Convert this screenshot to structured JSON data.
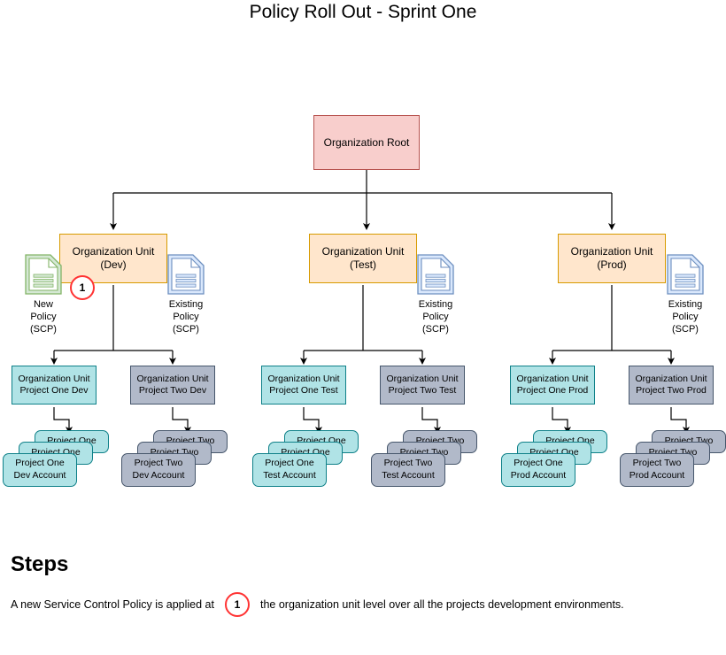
{
  "title": "Policy Roll Out - Sprint One",
  "colors": {
    "root_fill": "#f8cecc",
    "root_stroke": "#b85450",
    "ou_fill": "#ffe6cc",
    "ou_stroke": "#d79b00",
    "teal_fill": "#b0e3e6",
    "teal_stroke": "#0e8088",
    "slate_fill": "#b1b9c9",
    "slate_stroke": "#46566b",
    "badge_stroke": "#ff3333",
    "new_policy": "#82b366",
    "existing_policy": "#6c8ebf",
    "wire": "#000000"
  },
  "root": {
    "label": "Organization Root"
  },
  "branches": [
    {
      "ou_label_line1": "Organization Unit",
      "ou_label_line2": "(Dev)",
      "new_policy": {
        "icon": "document-icon",
        "label_line1": "New",
        "label_line2": "Policy",
        "label_line3": "(SCP)"
      },
      "existing_policy": {
        "icon": "document-icon",
        "label_line1": "Existing",
        "label_line2": "Policy",
        "label_line3": "(SCP)"
      },
      "badge": "1",
      "projects": [
        {
          "unit_line1": "Organization Unit",
          "unit_line2": "Project One Dev",
          "theme": "teal",
          "cards": [
            "Project One",
            "Project One",
            "Project One"
          ],
          "front_line2": "Dev Account"
        },
        {
          "unit_line1": "Organization Unit",
          "unit_line2": "Project Two Dev",
          "theme": "slate",
          "cards": [
            "Project Two",
            "Project Two",
            "Project Two"
          ],
          "front_line2": "Dev Account"
        }
      ]
    },
    {
      "ou_label_line1": "Organization Unit",
      "ou_label_line2": "(Test)",
      "existing_policy": {
        "icon": "document-icon",
        "label_line1": "Existing",
        "label_line2": "Policy",
        "label_line3": "(SCP)"
      },
      "projects": [
        {
          "unit_line1": "Organization Unit",
          "unit_line2": "Project One Test",
          "theme": "teal",
          "cards": [
            "Project One",
            "Project One",
            "Project One"
          ],
          "front_line2": "Test Account"
        },
        {
          "unit_line1": "Organization Unit",
          "unit_line2": "Project Two Test",
          "theme": "slate",
          "cards": [
            "Project Two",
            "Project Two",
            "Project Two"
          ],
          "front_line2": "Test Account"
        }
      ]
    },
    {
      "ou_label_line1": "Organization Unit",
      "ou_label_line2": "(Prod)",
      "existing_policy": {
        "icon": "document-icon",
        "label_line1": "Existing",
        "label_line2": "Policy",
        "label_line3": "(SCP)"
      },
      "projects": [
        {
          "unit_line1": "Organization Unit",
          "unit_line2": "Project One Prod",
          "theme": "teal",
          "cards": [
            "Project One",
            "Project One",
            "Project One"
          ],
          "front_line2": "Prod Account"
        },
        {
          "unit_line1": "Organization Unit",
          "unit_line2": "Project Two Prod",
          "theme": "slate",
          "cards": [
            "Project Two",
            "Project Two",
            "Project Two"
          ],
          "front_line2": "Prod Account"
        }
      ]
    }
  ],
  "steps": {
    "heading": "Steps",
    "text_before": "A new Service Control Policy is applied at",
    "badge": "1",
    "text_after": "the organization unit level over all the projects development environments."
  }
}
